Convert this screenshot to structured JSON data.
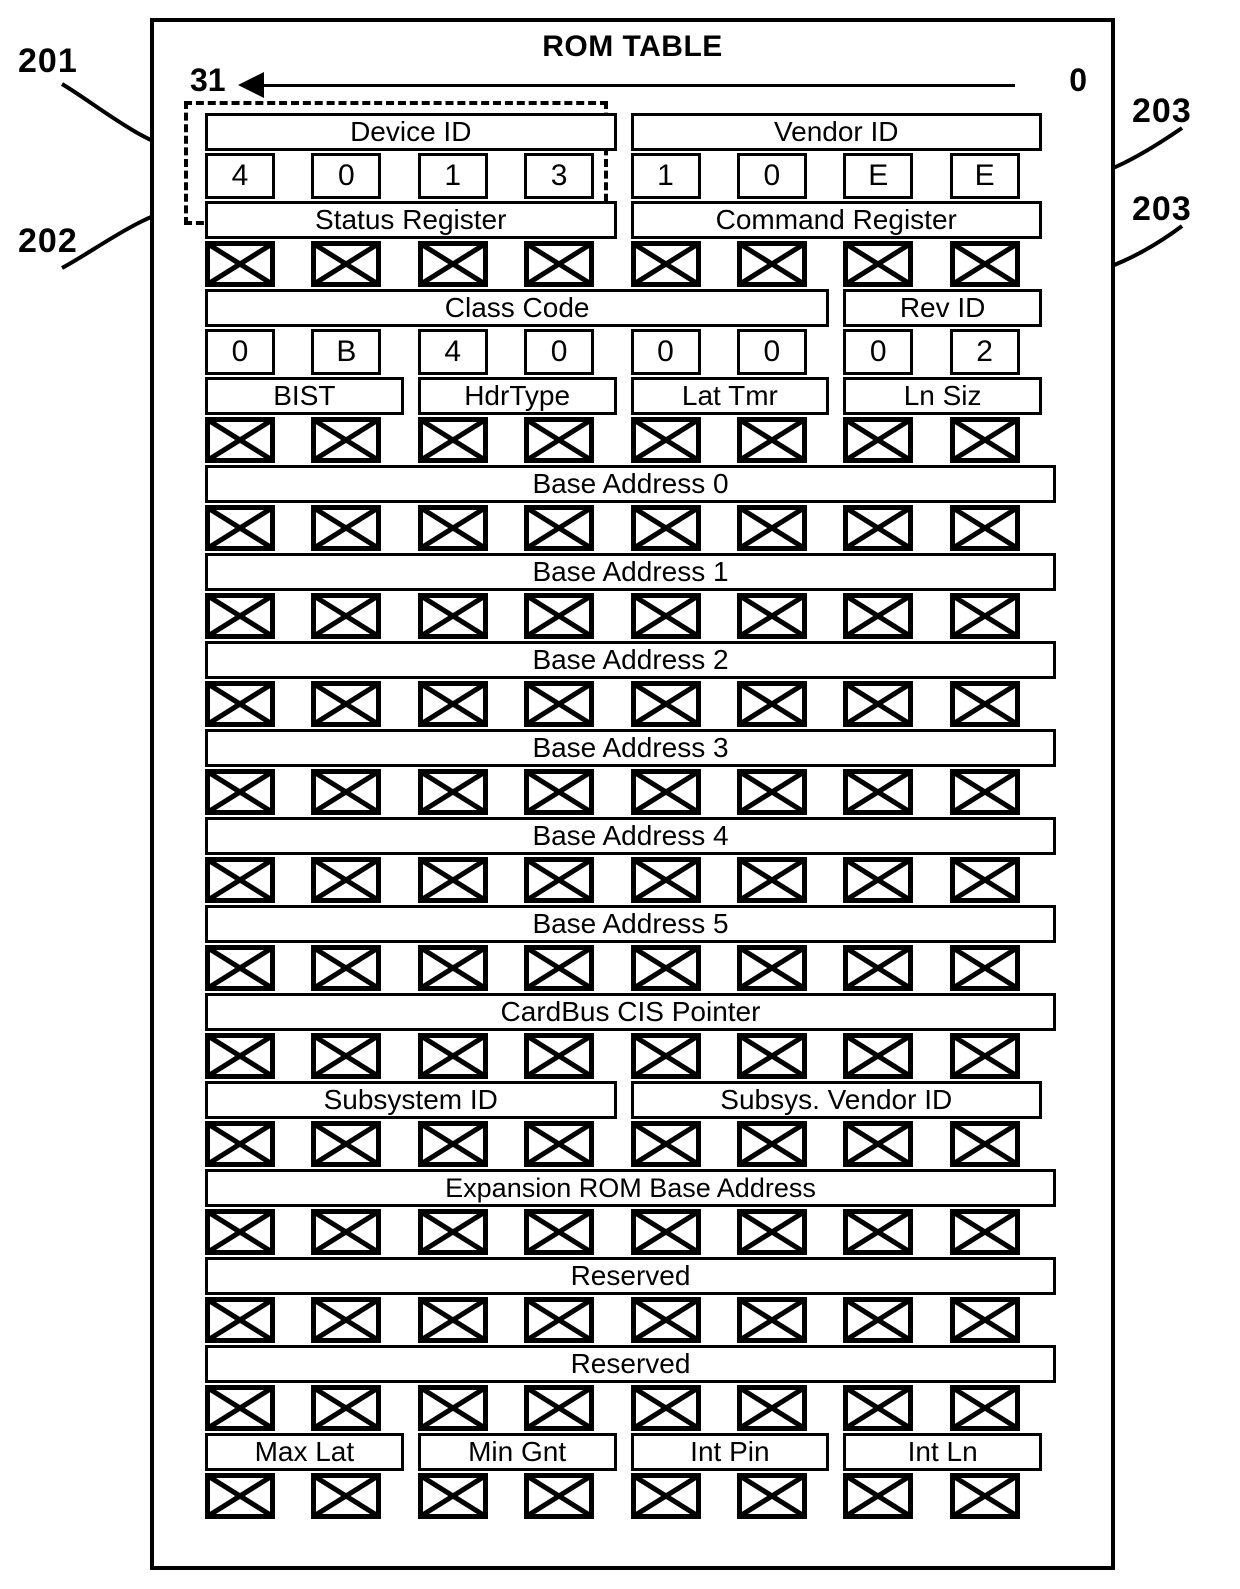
{
  "figure": {
    "title": "ROM TABLE",
    "bit_high": "31",
    "bit_low": "0",
    "callouts": [
      {
        "id": "ref-201",
        "label": "201"
      },
      {
        "id": "ref-202",
        "label": "202"
      },
      {
        "id": "ref-203-upper",
        "label": "203"
      },
      {
        "id": "ref-203-lower",
        "label": "203"
      }
    ]
  },
  "table": {
    "rows": [
      {
        "kind": "labels",
        "cells": [
          {
            "text": "Device ID",
            "start": 0,
            "span": 4
          },
          {
            "text": "Vendor ID",
            "start": 4,
            "span": 4
          }
        ]
      },
      {
        "kind": "values",
        "cells": [
          {
            "text": "4",
            "pos": 0
          },
          {
            "text": "0",
            "pos": 2
          },
          {
            "text": "1",
            "pos": 4
          },
          {
            "text": "3",
            "pos": 6
          },
          {
            "text": "1",
            "pos": 8
          },
          {
            "text": "0",
            "pos": 10
          },
          {
            "text": "E",
            "pos": 12
          },
          {
            "text": "E",
            "pos": 14
          }
        ]
      },
      {
        "kind": "labels",
        "cells": [
          {
            "text": "Status Register",
            "start": 0,
            "span": 4
          },
          {
            "text": "Command Register",
            "start": 4,
            "span": 4
          }
        ]
      },
      {
        "kind": "crosses",
        "positions": [
          0,
          2,
          4,
          6,
          8,
          10,
          12,
          14
        ]
      },
      {
        "kind": "labels",
        "cells": [
          {
            "text": "Class Code",
            "start": 0,
            "span": 6
          },
          {
            "text": "Rev ID",
            "start": 6,
            "span": 2
          }
        ]
      },
      {
        "kind": "values",
        "cells": [
          {
            "text": "0",
            "pos": 0
          },
          {
            "text": "B",
            "pos": 2
          },
          {
            "text": "4",
            "pos": 4
          },
          {
            "text": "0",
            "pos": 6
          },
          {
            "text": "0",
            "pos": 8
          },
          {
            "text": "0",
            "pos": 10
          },
          {
            "text": "0",
            "pos": 12
          },
          {
            "text": "2",
            "pos": 14
          }
        ]
      },
      {
        "kind": "labels",
        "cells": [
          {
            "text": "BIST",
            "start": 0,
            "span": 2
          },
          {
            "text": "HdrType",
            "start": 2,
            "span": 2
          },
          {
            "text": "Lat Tmr",
            "start": 4,
            "span": 2
          },
          {
            "text": "Ln Siz",
            "start": 6,
            "span": 2
          }
        ]
      },
      {
        "kind": "crosses",
        "positions": [
          0,
          2,
          4,
          6,
          8,
          10,
          12,
          14
        ]
      },
      {
        "kind": "labels",
        "cells": [
          {
            "text": "Base Address 0",
            "start": 0,
            "span": 8
          }
        ]
      },
      {
        "kind": "crosses",
        "positions": [
          0,
          2,
          4,
          6,
          8,
          10,
          12,
          14
        ]
      },
      {
        "kind": "labels",
        "cells": [
          {
            "text": "Base Address 1",
            "start": 0,
            "span": 8
          }
        ]
      },
      {
        "kind": "crosses",
        "positions": [
          0,
          2,
          4,
          6,
          8,
          10,
          12,
          14
        ]
      },
      {
        "kind": "labels",
        "cells": [
          {
            "text": "Base Address 2",
            "start": 0,
            "span": 8
          }
        ]
      },
      {
        "kind": "crosses",
        "positions": [
          0,
          2,
          4,
          6,
          8,
          10,
          12,
          14
        ]
      },
      {
        "kind": "labels",
        "cells": [
          {
            "text": "Base Address 3",
            "start": 0,
            "span": 8
          }
        ]
      },
      {
        "kind": "crosses",
        "positions": [
          0,
          2,
          4,
          6,
          8,
          10,
          12,
          14
        ]
      },
      {
        "kind": "labels",
        "cells": [
          {
            "text": "Base Address 4",
            "start": 0,
            "span": 8
          }
        ]
      },
      {
        "kind": "crosses",
        "positions": [
          0,
          2,
          4,
          6,
          8,
          10,
          12,
          14
        ]
      },
      {
        "kind": "labels",
        "cells": [
          {
            "text": "Base Address 5",
            "start": 0,
            "span": 8
          }
        ]
      },
      {
        "kind": "crosses",
        "positions": [
          0,
          2,
          4,
          6,
          8,
          10,
          12,
          14
        ]
      },
      {
        "kind": "labels",
        "cells": [
          {
            "text": "CardBus CIS Pointer",
            "start": 0,
            "span": 8
          }
        ]
      },
      {
        "kind": "crosses",
        "positions": [
          0,
          2,
          4,
          6,
          8,
          10,
          12,
          14
        ]
      },
      {
        "kind": "labels",
        "cells": [
          {
            "text": "Subsystem ID",
            "start": 0,
            "span": 4
          },
          {
            "text": "Subsys. Vendor ID",
            "start": 4,
            "span": 4
          }
        ]
      },
      {
        "kind": "crosses",
        "positions": [
          0,
          2,
          4,
          6,
          8,
          10,
          12,
          14
        ]
      },
      {
        "kind": "labels",
        "cells": [
          {
            "text": "Expansion ROM Base Address",
            "start": 0,
            "span": 8
          }
        ]
      },
      {
        "kind": "crosses",
        "positions": [
          0,
          2,
          4,
          6,
          8,
          10,
          12,
          14
        ]
      },
      {
        "kind": "labels",
        "cells": [
          {
            "text": "Reserved",
            "start": 0,
            "span": 8
          }
        ]
      },
      {
        "kind": "crosses",
        "positions": [
          0,
          2,
          4,
          6,
          8,
          10,
          12,
          14
        ]
      },
      {
        "kind": "labels",
        "cells": [
          {
            "text": "Reserved",
            "start": 0,
            "span": 8
          }
        ]
      },
      {
        "kind": "crosses",
        "positions": [
          0,
          2,
          4,
          6,
          8,
          10,
          12,
          14
        ]
      },
      {
        "kind": "labels",
        "cells": [
          {
            "text": "Max Lat",
            "start": 0,
            "span": 2
          },
          {
            "text": "Min Gnt",
            "start": 2,
            "span": 2
          },
          {
            "text": "Int Pin",
            "start": 4,
            "span": 2
          },
          {
            "text": "Int Ln",
            "start": 6,
            "span": 2
          }
        ]
      },
      {
        "kind": "crosses",
        "positions": [
          0,
          2,
          4,
          6,
          8,
          10,
          12,
          14
        ]
      }
    ]
  }
}
